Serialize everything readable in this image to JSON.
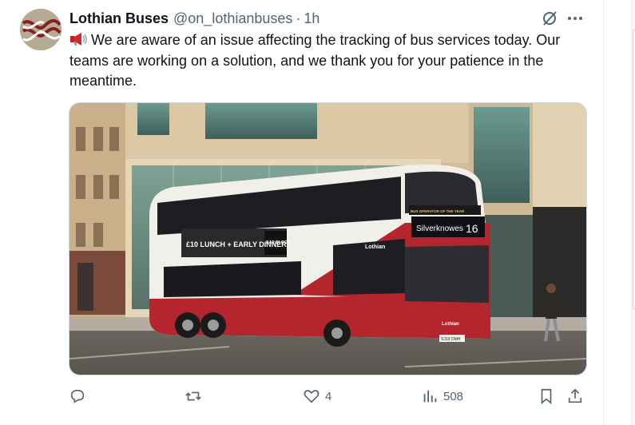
{
  "tweet": {
    "display_name": "Lothian Buses",
    "handle": "@on_lothianbuses",
    "separator": "·",
    "time": "1h",
    "text": "We are aware of an issue affecting the tracking of bus services today. Our teams are working on a solution, and we thank you for your patience in the meantime.",
    "leading_emoji": "megaphone-icon"
  },
  "media": {
    "bus_destination": "Silverknowes",
    "bus_route": "16",
    "bus_brand": "Lothian",
    "bus_award": "BUS OPERATOR OF THE YEAR",
    "ad_text": "£10 LUNCH + EARLY DINNER",
    "ad_brand": "BAR BLOCK",
    "plate": "SJ19 OMH"
  },
  "actions": {
    "replies": "",
    "reposts": "",
    "likes": "4",
    "views": "508"
  },
  "colors": {
    "text": "#0f1419",
    "secondary": "#536471",
    "bus_red": "#b3262e",
    "border": "#cfd9de"
  }
}
